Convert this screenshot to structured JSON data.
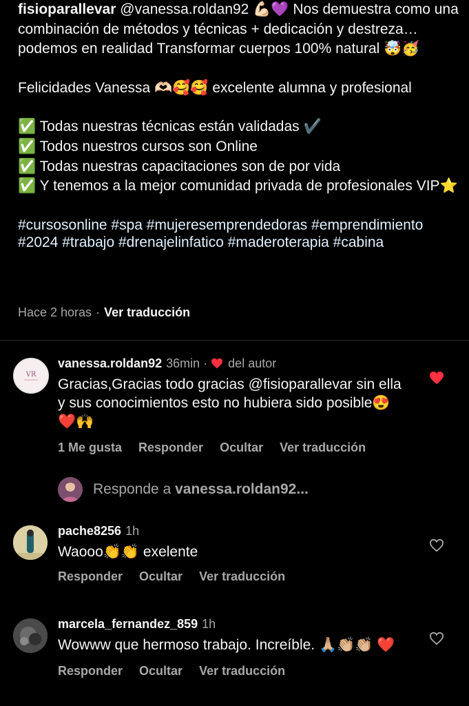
{
  "caption": {
    "username": "fisioparallevar",
    "line1_rest": "@vanessa.roldan92 💪🏻💜 Nos demuestra como una combinación de métodos y técnicas + dedicación y destreza… podemos en realidad Transformar cuerpos 100% natural 🤯🥳",
    "felicidades": "Felicidades Vanessa 🫶🏻🥰🥰 excelente alumna y profesional",
    "checks": [
      "✅ Todas nuestras técnicas están validadas ✔️",
      "✅ Todos nuestros cursos son Online",
      "✅ Todas nuestras capacitaciones son de por vida",
      "✅ Y tenemos a la mejor comunidad privada de profesionales VIP⭐"
    ],
    "hashtags": "#cursosonline #spa #mujeresemprendedoras #emprendimiento #2024 #trabajo #drenajelinfatico #maderoterapia #cabina",
    "time": "Hace 2 horas",
    "separator": "·",
    "translate": "Ver traducción"
  },
  "comments": [
    {
      "username": "vanessa.roldan92",
      "time": "36min",
      "dot": "·",
      "author_label": "del autor",
      "text_before": "Gracias,Gracias todo gracias ",
      "mention": "@fisioparallevar",
      "text_after": " sin ella y sus conocimientos esto no hubiera sido posible😍❤️🙌",
      "likes": "1 Me gusta",
      "reply": "Responder",
      "hide": "Ocultar",
      "translate": "Ver traducción",
      "liked": true
    },
    {
      "username": "pache8256",
      "time": "1h",
      "text": "Waooo👏👏 exelente",
      "reply": "Responder",
      "hide": "Ocultar",
      "translate": "Ver traducción",
      "liked": false
    },
    {
      "username": "marcela_fernandez_859",
      "time": "1h",
      "text": "Wowww que hermoso trabajo. Increíble. 🙏🏼👏🏼👏🏼 ❤️",
      "reply": "Responder",
      "hide": "Ocultar",
      "translate": "Ver traducción",
      "liked": false
    }
  ],
  "reply_prompt": {
    "prefix": "Responde a ",
    "username": "vanessa.roldan92..."
  },
  "colors": {
    "background": "#000000",
    "text": "#f5f5f5",
    "secondary": "#a8a8a8",
    "like_red": "#ff3040"
  },
  "icons": {
    "heart_filled": "heart-filled-icon",
    "heart_outline": "heart-outline-icon"
  }
}
